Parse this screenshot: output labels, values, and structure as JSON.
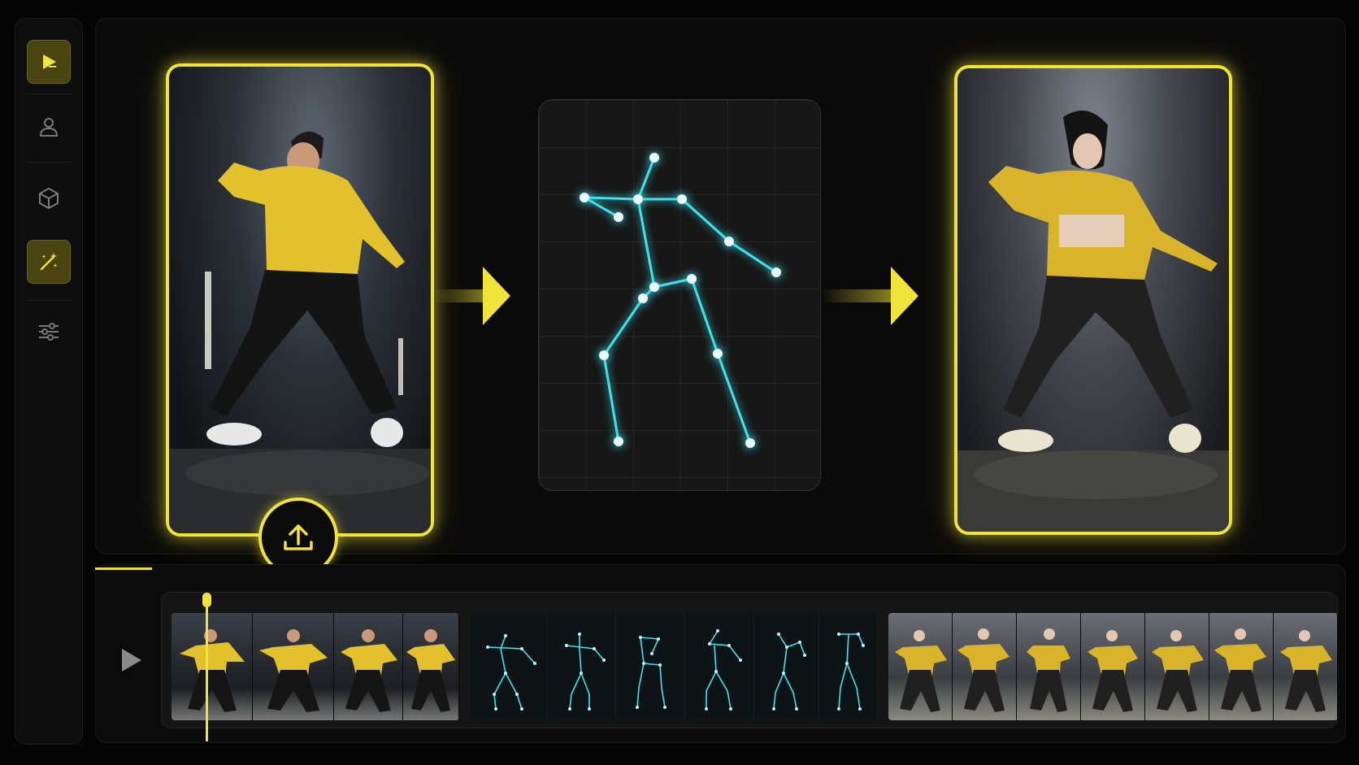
{
  "app": {
    "accent": "#f0e33a",
    "pose_color": "#3fe3ee"
  },
  "sidebar": {
    "items": [
      {
        "icon": "play-logo-icon",
        "active": true
      },
      {
        "icon": "user-icon",
        "active": false
      },
      {
        "icon": "cube-icon",
        "active": false
      },
      {
        "icon": "magic-wand-icon",
        "active": true
      },
      {
        "icon": "sliders-icon",
        "active": false
      }
    ]
  },
  "workflow": {
    "source": {
      "icon": "upload-icon"
    },
    "pose": {
      "joints": 14
    },
    "result": {}
  },
  "timeline": {
    "source_frames": 4,
    "pose_frames": 6,
    "result_frames": 7,
    "playhead_progress": 0.04
  }
}
